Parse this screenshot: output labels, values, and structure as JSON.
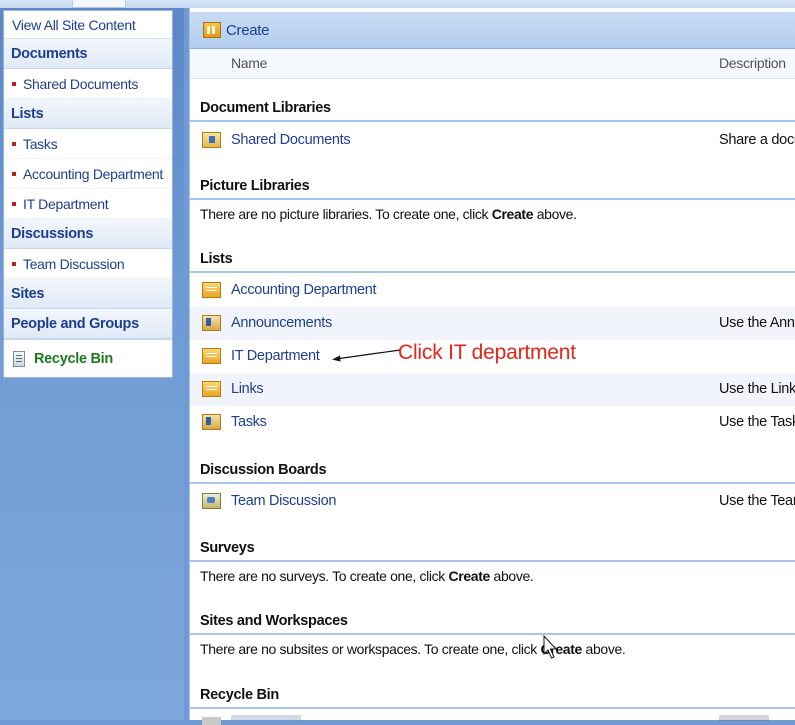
{
  "quick_launch": {
    "view_all": "View All Site Content",
    "sections": [
      {
        "heading": "Documents",
        "items": [
          "Shared Documents"
        ]
      },
      {
        "heading": "Lists",
        "items": [
          "Tasks",
          "Accounting Department",
          "IT Department"
        ]
      },
      {
        "heading": "Discussions",
        "items": [
          "Team Discussion"
        ]
      },
      {
        "heading": "Sites",
        "items": []
      },
      {
        "heading": "People and Groups",
        "items": []
      }
    ],
    "recycle_bin": "Recycle Bin"
  },
  "main": {
    "title": "Create",
    "columns": {
      "name": "Name",
      "description": "Description"
    },
    "sections": {
      "document_libraries": {
        "heading": "Document Libraries",
        "rows": [
          {
            "name": "Shared Documents",
            "description": "Share a docu"
          }
        ]
      },
      "picture_libraries": {
        "heading": "Picture Libraries",
        "empty_before": "There are no picture libraries. To create one, click ",
        "empty_bold": "Create",
        "empty_after": " above."
      },
      "lists": {
        "heading": "Lists",
        "rows": [
          {
            "name": "Accounting Department",
            "description": ""
          },
          {
            "name": "Announcements",
            "description": "Use the Ann"
          },
          {
            "name": "IT Department",
            "description": ""
          },
          {
            "name": "Links",
            "description": "Use the Links"
          },
          {
            "name": "Tasks",
            "description": "Use the Task"
          }
        ]
      },
      "discussion_boards": {
        "heading": "Discussion Boards",
        "rows": [
          {
            "name": "Team Discussion",
            "description": "Use the Tear"
          }
        ]
      },
      "surveys": {
        "heading": "Surveys",
        "empty_before": "There are no surveys. To create one, click ",
        "empty_bold": "Create",
        "empty_after": " above."
      },
      "sites_workspaces": {
        "heading": "Sites and Workspaces",
        "empty_before": "There are no subsites or workspaces. To create one, click ",
        "empty_bold": "Create",
        "empty_after": " above."
      },
      "recycle_bin": {
        "heading": "Recycle Bin"
      }
    }
  },
  "annotation": {
    "text": "Click IT department",
    "color": "#e2261c"
  },
  "colors": {
    "link": "#1f3f8e",
    "heading": "#1c3f93",
    "recycle": "#1d7a1d",
    "bullet": "#b3241e"
  }
}
